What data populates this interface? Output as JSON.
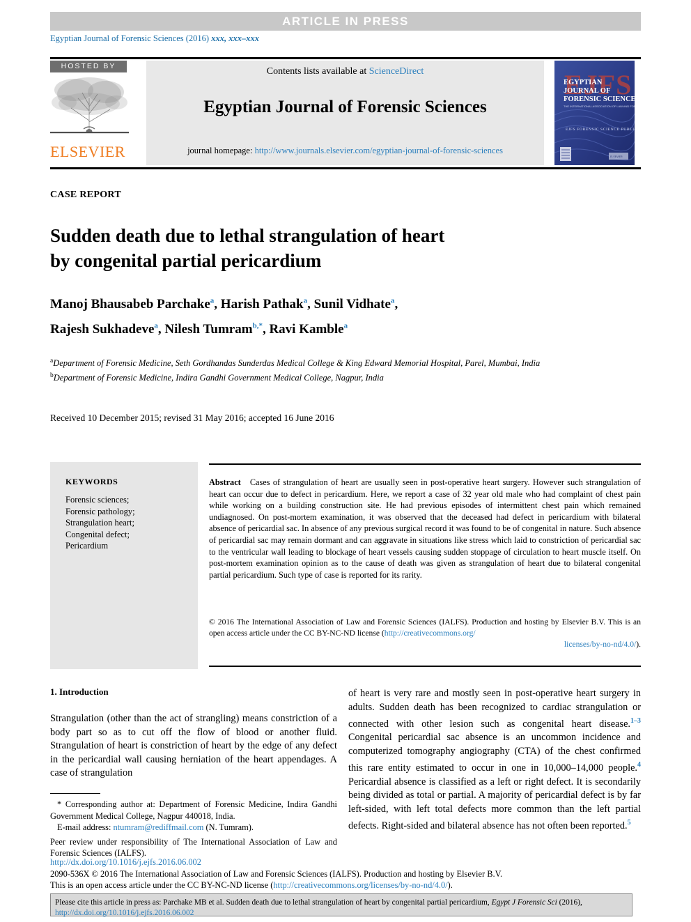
{
  "banner": {
    "text": "ARTICLE  IN  PRESS"
  },
  "journal_line": {
    "prefix": "Egyptian Journal of Forensic Sciences (2016)",
    "volume": "xxx, xxx–xxx"
  },
  "masthead": {
    "hosted_by": "HOSTED BY",
    "publisher": "ELSEVIER",
    "contents_prefix": "Contents lists available at ",
    "contents_link": "ScienceDirect",
    "journal_title": "Egyptian Journal of Forensic Sciences",
    "homepage_label": "journal homepage: ",
    "homepage_url": "http://www.journals.elsevier.com/egyptian-journal-of-forensic-sciences",
    "cover": {
      "acronym": "EJFS",
      "line1": "EGYPTIAN",
      "line2": "JOURNAL OF",
      "line3": "FORENSIC SCIENCES",
      "subtitle": "THE INTERNATIONAL ASSOCIATION OF LAW AND FORENSIC SCIENCES",
      "tagline": "EJFS  FORENSIC SCIENCE PUBLISHES ARTICLES"
    }
  },
  "article": {
    "type_label": "CASE REPORT",
    "title_line1": "Sudden death due to lethal strangulation of heart",
    "title_line2": "by congenital partial pericardium",
    "authors_line1": "Manoj Bhausabeb Parchake a, Harish Pathak a, Sunil Vidhate a,",
    "authors_line2": "Rajesh Sukhadeve a, Nilesh Tumram b,*, Ravi Kamble a",
    "affiliation_a": "Department of Forensic Medicine, Seth Gordhandas Sunderdas Medical College & King Edward Memorial Hospital, Parel, Mumbai, India",
    "affiliation_b": "Department of Forensic Medicine, Indira Gandhi Government Medical College, Nagpur, India",
    "dates": "Received 10 December 2015; revised 31 May 2016; accepted 16 June 2016"
  },
  "keywords": {
    "heading": "KEYWORDS",
    "items": [
      "Forensic sciences;",
      "Forensic pathology;",
      "Strangulation heart;",
      "Congenital defect;",
      "Pericardium"
    ]
  },
  "abstract": {
    "label": "Abstract",
    "body": "Cases of strangulation of heart are usually seen in post-operative heart surgery. However such strangulation of heart can occur due to defect in pericardium. Here, we report a case of 32 year old male who had complaint of chest pain while working on a building construction site. He had previous episodes of intermittent chest pain which remained undiagnosed. On post-mortem examination, it was observed that the deceased had defect in pericardium with bilateral absence of pericardial sac. In absence of any previous surgical record it was found to be of congenital in nature. Such absence of pericardial sac may remain dormant and can aggravate in situations like stress which laid to constriction of pericardial sac to the ventricular wall leading to blockage of heart vessels causing sudden stoppage of circulation to heart muscle itself. On post-mortem examination opinion as to the cause of death was given as strangulation of heart due to bilateral congenital partial pericardium. Such type of case is reported for its rarity.",
    "copyright_text": "© 2016 The International Association of Law and Forensic Sciences (IALFS). Production and hosting by Elsevier B.V. This is an open access article under the CC BY-NC-ND license (",
    "copyright_link1": "http://creativecommons.org/",
    "copyright_link2": "licenses/by-no-nd/4.0/",
    "copyright_tail": ")."
  },
  "body": {
    "section_heading": "1. Introduction",
    "left_paragraph": "Strangulation (other than the act of strangling) means constriction of a body part so as to cut off the flow of blood or another fluid. Strangulation of heart is constriction of heart by the edge of any defect in the pericardial wall causing herniation of the heart appendages. A case of strangulation",
    "right_part1": "of heart is very rare and mostly seen in post-operative heart surgery in adults. Sudden death has been recognized to cardiac strangulation or connected with other lesion such as congenital heart disease.",
    "right_ref1": "1–3",
    "right_part2": " Congenital pericardial sac absence is an uncommon incidence and computerized tomography angiography (CTA) of the chest confirmed this rare entity estimated to occur in one in 10,000–14,000 people.",
    "right_ref2": "4",
    "right_part3": " Pericardial absence is classified as a left or right defect. It is secondarily being divided as total or partial. A majority of pericardial defect is by far left-sided, with left total defects more common than the left partial defects. Right-sided and bilateral absence has not often been reported.",
    "right_ref3": "5"
  },
  "footnotes": {
    "corresponding": "* Corresponding author at: Department of Forensic Medicine, Indira Gandhi Government Medical College, Nagpur 440018, India.",
    "email_label": "E-mail address: ",
    "email_value": "ntumram@rediffmail.com",
    "email_suffix": " (N. Tumram).",
    "peer_review": "Peer review under responsibility of The International Association of Law and Forensic Sciences (IALFS)."
  },
  "doi_block": {
    "doi_url": "http://dx.doi.org/10.1016/j.ejfs.2016.06.002",
    "issn_line": "2090-536X © 2016 The International Association of Law and Forensic Sciences (IALFS). Production and hosting by Elsevier B.V.",
    "license_prefix": "This is an open access article under the CC BY-NC-ND license (",
    "license_link": "http://creativecommons.org/licenses/by-no-nd/4.0/",
    "license_suffix": ")."
  },
  "cite_box": {
    "prefix": "Please cite this article in press as: Parchake MB et al. Sudden death due to lethal strangulation of heart by congenital partial pericardium, ",
    "journal_abbrev": "Egypt J Forensic Sci",
    "year": " (2016),",
    "doi": "http://dx.doi.org/10.1016/j.ejfs.2016.06.002"
  },
  "colors": {
    "link": "#2b7fbd",
    "banner_bg": "#c8c8c8",
    "elsevier_orange": "#ef7d22",
    "masthead_bg": "#e8e8e8",
    "keyword_bg": "#e6e6e6",
    "cite_bg": "#d9d9d9"
  }
}
